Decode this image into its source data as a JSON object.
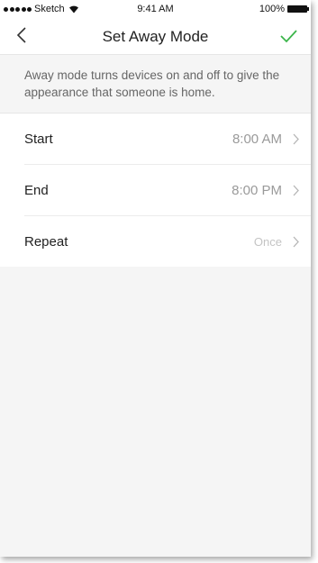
{
  "status_bar": {
    "carrier": "Sketch",
    "time": "9:41 AM",
    "battery": "100%"
  },
  "nav": {
    "title": "Set Away Mode",
    "back_icon": "chevron-left-icon",
    "confirm_icon": "checkmark-icon",
    "confirm_color": "#3bb54a"
  },
  "description": "Away mode turns devices on and off to give the appearance that someone is home.",
  "settings": [
    {
      "label": "Start",
      "value": "8:00 AM"
    },
    {
      "label": "End",
      "value": "8:00 PM"
    },
    {
      "label": "Repeat",
      "value": "Once"
    }
  ]
}
